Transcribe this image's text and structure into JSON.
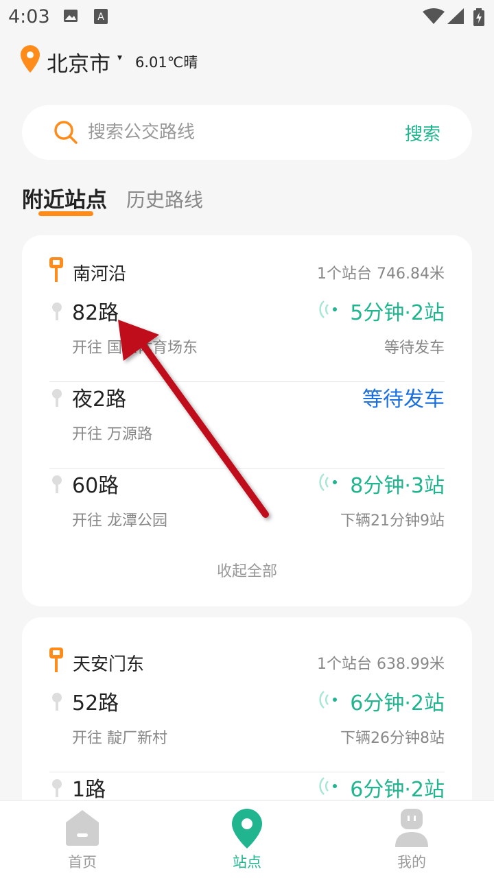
{
  "status": {
    "time": "4:03"
  },
  "header": {
    "city": "北京市",
    "caret": "▾",
    "weather": "6.01℃晴"
  },
  "search": {
    "placeholder": "搜索公交路线",
    "button": "搜索"
  },
  "tabs": [
    {
      "label": "附近站点",
      "active": true
    },
    {
      "label": "历史路线",
      "active": false
    }
  ],
  "stations": [
    {
      "name": "南河沿",
      "meta": "1个站台 746.84米",
      "routes": [
        {
          "name": "82路",
          "dest": "开往 国家体育场东",
          "eta": "5分钟·2站",
          "sub": "等待发车"
        },
        {
          "name": "夜2路",
          "dest": "开往 万源路",
          "eta": "等待发车",
          "sub": ""
        },
        {
          "name": "60路",
          "dest": "开往 龙潭公园",
          "eta": "8分钟·3站",
          "sub": "下辆21分钟9站"
        }
      ],
      "collapse": "收起全部"
    },
    {
      "name": "天安门东",
      "meta": "1个站台 638.99米",
      "routes": [
        {
          "name": "52路",
          "dest": "开往 靛厂新村",
          "eta": "6分钟·2站",
          "sub": "下辆26分钟8站"
        },
        {
          "name": "1路",
          "dest": "",
          "eta": "6分钟·2站",
          "sub": ""
        }
      ]
    }
  ],
  "nav": [
    {
      "label": "首页",
      "icon": "home-icon"
    },
    {
      "label": "站点",
      "icon": "station-pin-icon"
    },
    {
      "label": "我的",
      "icon": "profile-icon"
    }
  ],
  "colors": {
    "accent": "#20b58f",
    "orange": "#ff8c1a",
    "blue": "#1a6fe0",
    "arrow": "#c0101a"
  }
}
